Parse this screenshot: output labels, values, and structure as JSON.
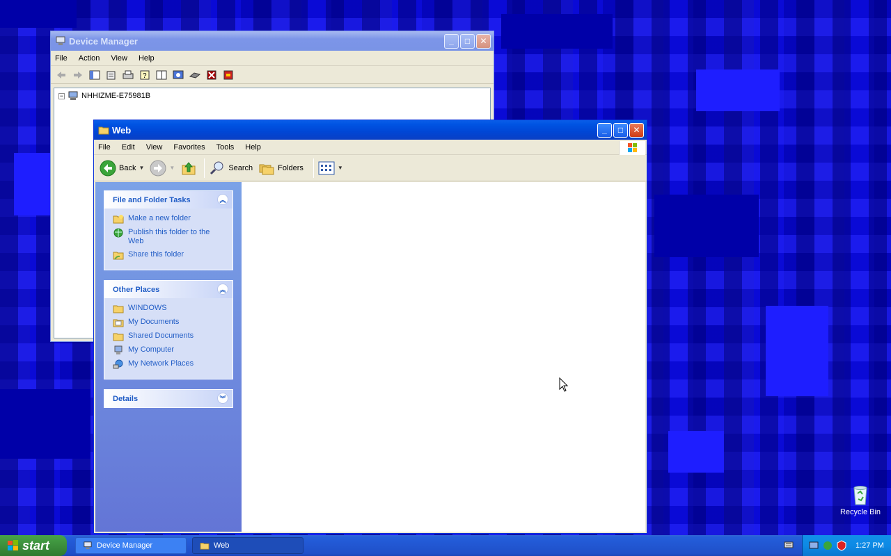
{
  "device_manager": {
    "title": "Device Manager",
    "menu": [
      "File",
      "Action",
      "View",
      "Help"
    ],
    "tree_root": "NHHIZME-E75981B",
    "tree_expander": "−"
  },
  "web": {
    "title": "Web",
    "menu": [
      "File",
      "Edit",
      "View",
      "Favorites",
      "Tools",
      "Help"
    ],
    "toolbar": {
      "back": "Back",
      "search": "Search",
      "folders": "Folders"
    },
    "tasks": {
      "title": "File and Folder Tasks",
      "items": [
        "Make a new folder",
        "Publish this folder to the Web",
        "Share this folder"
      ]
    },
    "places": {
      "title": "Other Places",
      "items": [
        "WINDOWS",
        "My Documents",
        "Shared Documents",
        "My Computer",
        "My Network Places"
      ]
    },
    "details": {
      "title": "Details"
    }
  },
  "taskbar": {
    "start": "start",
    "tasks": [
      "Device Manager",
      "Web"
    ],
    "clock": "1:27 PM"
  },
  "desktop": {
    "recycle_bin": "Recycle Bin"
  },
  "colors": {
    "accent": "#0054e3",
    "link": "#215dc6",
    "start": "#3c8f3c"
  }
}
